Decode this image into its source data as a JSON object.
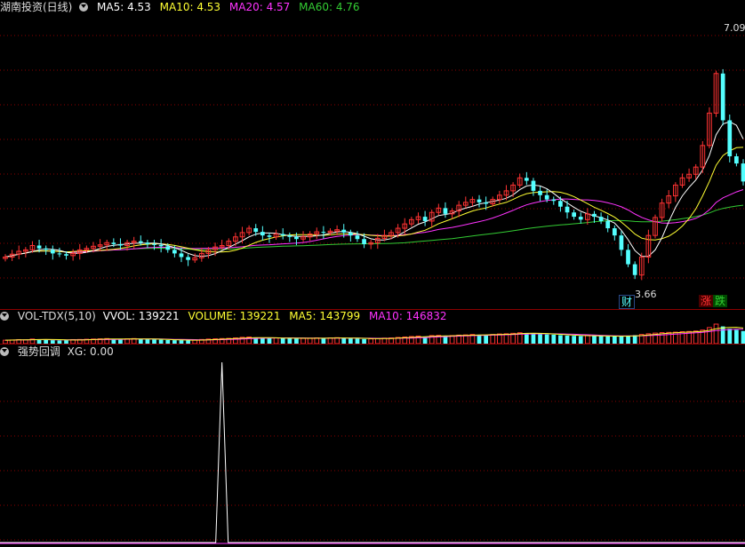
{
  "main": {
    "title": "湖南投资(日线)",
    "ma": [
      {
        "label": "MA5: 4.53",
        "color": "#ffffff"
      },
      {
        "label": "MA10: 4.53",
        "color": "#ffff33"
      },
      {
        "label": "MA20: 4.57",
        "color": "#ff33ff"
      },
      {
        "label": "MA60: 4.76",
        "color": "#33cc33"
      }
    ],
    "high_label": "7.09",
    "low_label": "3.66",
    "tag_cai": "财",
    "tag_zhang": "涨",
    "tag_die": "跌"
  },
  "volume": {
    "name": "VOL-TDX(5,10)",
    "items": [
      {
        "label": "VVOL: 139221",
        "color": "#ffffff"
      },
      {
        "label": "VOLUME: 139221",
        "color": "#ffff33"
      },
      {
        "label": "MA5: 143799",
        "color": "#ffff33"
      },
      {
        "label": "MA10: 146832",
        "color": "#ff33ff"
      }
    ]
  },
  "indicator": {
    "name": "强势回调",
    "items": [
      {
        "label": "XG: 0.00",
        "color": "#dddddd"
      }
    ]
  },
  "colors": {
    "up": "#ff3333",
    "down": "#54ffff",
    "grid": "#8b0000",
    "ma5": "#ffffff",
    "ma10": "#ffff33",
    "ma20": "#ff33ff",
    "ma60": "#33cc33"
  },
  "chart_data": {
    "type": "candlestick",
    "price_range": [
      3.5,
      7.3
    ],
    "closes": [
      4.0,
      4.04,
      4.08,
      4.1,
      4.16,
      4.12,
      4.1,
      4.05,
      4.04,
      4.02,
      4.05,
      4.1,
      4.12,
      4.15,
      4.17,
      4.2,
      4.18,
      4.16,
      4.2,
      4.22,
      4.2,
      4.18,
      4.17,
      4.15,
      4.1,
      4.05,
      4.0,
      3.96,
      3.99,
      4.05,
      4.1,
      4.14,
      4.16,
      4.22,
      4.28,
      4.34,
      4.4,
      4.35,
      4.3,
      4.28,
      4.32,
      4.3,
      4.28,
      4.25,
      4.28,
      4.32,
      4.35,
      4.34,
      4.36,
      4.38,
      4.34,
      4.3,
      4.25,
      4.18,
      4.2,
      4.26,
      4.3,
      4.34,
      4.4,
      4.46,
      4.52,
      4.56,
      4.5,
      4.62,
      4.68,
      4.6,
      4.64,
      4.72,
      4.76,
      4.8,
      4.76,
      4.74,
      4.8,
      4.86,
      4.92,
      5.0,
      5.1,
      5.06,
      4.92,
      4.86,
      4.8,
      4.78,
      4.7,
      4.62,
      4.56,
      4.52,
      4.6,
      4.56,
      4.5,
      4.4,
      4.3,
      4.1,
      3.9,
      3.75,
      4.0,
      4.3,
      4.55,
      4.75,
      4.85,
      5.0,
      5.1,
      5.15,
      5.25,
      5.55,
      6.0,
      6.55,
      5.9,
      5.4,
      5.3,
      5.05
    ],
    "volumes": [
      30,
      32,
      35,
      33,
      40,
      38,
      36,
      30,
      28,
      30,
      35,
      36,
      38,
      40,
      42,
      44,
      40,
      38,
      42,
      44,
      40,
      38,
      36,
      34,
      32,
      30,
      30,
      28,
      32,
      36,
      40,
      42,
      44,
      46,
      50,
      55,
      58,
      52,
      48,
      46,
      50,
      48,
      46,
      44,
      46,
      48,
      50,
      48,
      50,
      52,
      48,
      46,
      44,
      40,
      42,
      46,
      48,
      50,
      54,
      58,
      62,
      66,
      60,
      70,
      72,
      68,
      70,
      74,
      76,
      80,
      78,
      76,
      80,
      84,
      86,
      90,
      95,
      92,
      88,
      84,
      80,
      78,
      74,
      70,
      68,
      66,
      70,
      68,
      66,
      64,
      62,
      66,
      70,
      74,
      80,
      86,
      92,
      96,
      98,
      100,
      104,
      106,
      110,
      118,
      140,
      170,
      150,
      130,
      120,
      110
    ],
    "xg_signal_index": 32
  }
}
